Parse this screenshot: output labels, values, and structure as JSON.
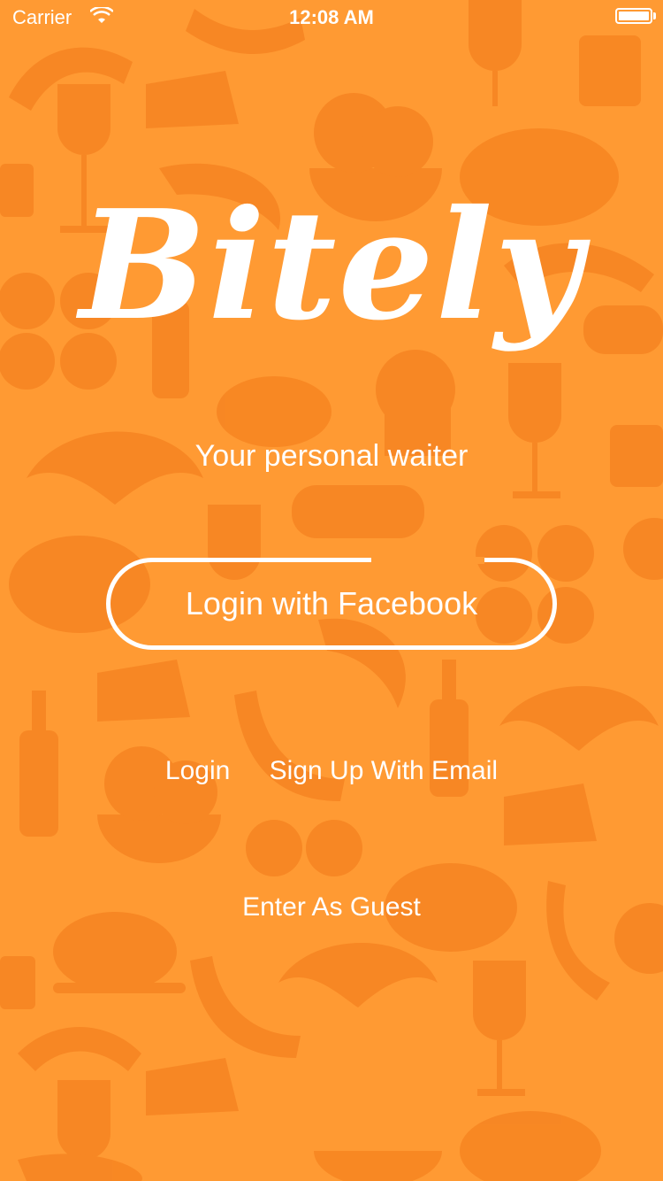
{
  "status_bar": {
    "carrier": "Carrier",
    "time": "12:08 AM"
  },
  "app": {
    "logo": "Bitely",
    "tagline": "Your personal waiter"
  },
  "actions": {
    "facebook_login": "Login with Facebook",
    "login": "Login",
    "signup_email": "Sign Up With Email",
    "guest": "Enter As Guest"
  },
  "colors": {
    "background": "#ff9a33",
    "pattern": "#f07a1a",
    "text": "#ffffff"
  }
}
